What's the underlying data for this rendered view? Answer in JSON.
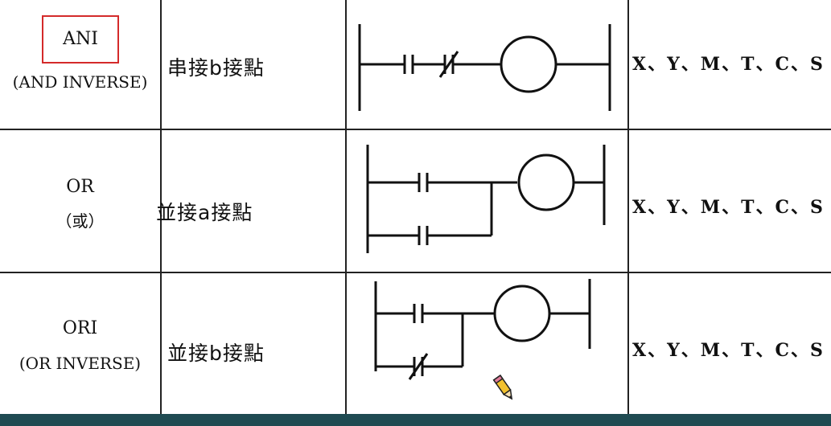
{
  "rows": [
    {
      "instruction": "ANI",
      "instruction_sub": "(AND INVERSE)",
      "description": "串接b接點",
      "devices": "X、Y、M、T、C、S",
      "diagram": "series-nc-coil"
    },
    {
      "instruction": "OR",
      "instruction_sub": "（或）",
      "description": "並接a接點",
      "devices": "X、Y、M、T、C、S",
      "diagram": "parallel-no-coil"
    },
    {
      "instruction": "ORI",
      "instruction_sub": "(OR INVERSE)",
      "description": "並接b接點",
      "devices": "X、Y、M、T、C、S",
      "diagram": "parallel-nc-coil"
    }
  ],
  "colors": {
    "highlight": "#d42a2a",
    "taskbar": "#1f4b52",
    "grid": "#222222"
  },
  "icons": [
    "pencil-cursor-icon"
  ]
}
